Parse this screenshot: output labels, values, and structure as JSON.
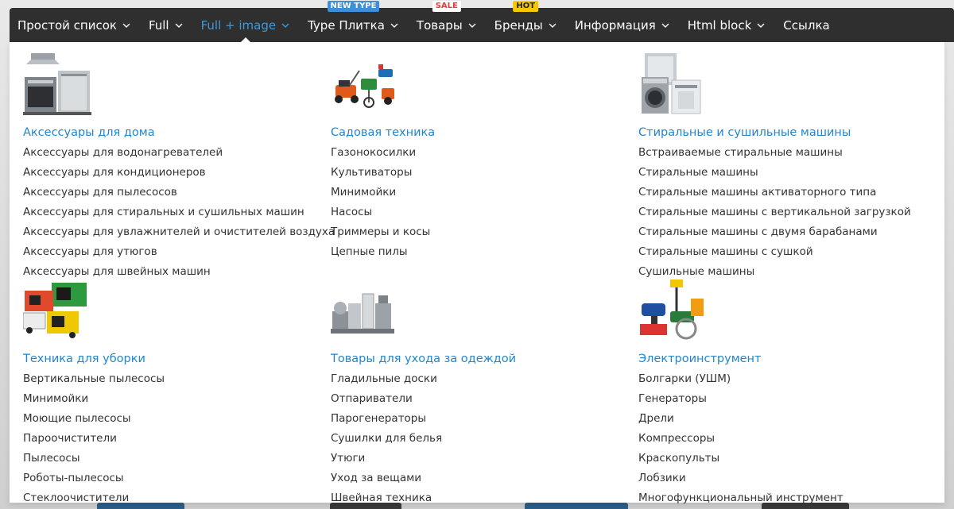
{
  "menu": {
    "items": [
      {
        "label": "Простой список",
        "has_dropdown": true,
        "active": false,
        "badge": null
      },
      {
        "label": "Full",
        "has_dropdown": true,
        "active": false,
        "badge": null
      },
      {
        "label": "Full + image",
        "has_dropdown": true,
        "active": true,
        "badge": null
      },
      {
        "label": "Type Плитка",
        "has_dropdown": true,
        "active": false,
        "badge": {
          "text": "NEW TYPE",
          "style": "new"
        }
      },
      {
        "label": "Товары",
        "has_dropdown": true,
        "active": false,
        "badge": {
          "text": "SALE",
          "style": "sale"
        }
      },
      {
        "label": "Бренды",
        "has_dropdown": true,
        "active": false,
        "badge": {
          "text": "HOT",
          "style": "hot"
        }
      },
      {
        "label": "Информация",
        "has_dropdown": true,
        "active": false,
        "badge": null
      },
      {
        "label": "Html block",
        "has_dropdown": true,
        "active": false,
        "badge": null
      },
      {
        "label": "Ссылка",
        "has_dropdown": false,
        "active": false,
        "badge": null
      }
    ],
    "colors": {
      "bar": "#2f2f2f",
      "active": "#3d9ade",
      "link": "#1f86cf"
    }
  },
  "dropdown": {
    "sections": [
      {
        "title": "Аксессуары для дома",
        "image": "kitchen-appliances-icon",
        "links": [
          "Аксессуары для водонагревателей",
          "Аксессуары для кондиционеров",
          "Аксессуары для пылесосов",
          "Аксессуары для стиральных и сушильных машин",
          "Аксессуары для увлажнителей и очистителей воздуха",
          "Аксессуары для утюгов",
          "Аксессуары для швейных машин"
        ]
      },
      {
        "title": "Садовая техника",
        "image": "garden-tools-icon",
        "links": [
          "Газонокосилки",
          "Культиваторы",
          "Минимойки",
          "Насосы",
          "Триммеры и косы",
          "Цепные пилы"
        ]
      },
      {
        "title": "Стиральные и сушильные машины",
        "image": "washing-machines-icon",
        "links": [
          "Встраиваемые стиральные машины",
          "Стиральные машины",
          "Стиральные машины активаторного типа",
          "Стиральные машины с вертикальной загрузкой",
          "Стиральные машины с двумя барабанами",
          "Стиральные машины с сушкой",
          "Сушильные машины"
        ]
      },
      {
        "title": "Техника для уборки",
        "image": "generators-icon",
        "links": [
          "Вертикальные пылесосы",
          "Минимойки",
          "Моющие пылесосы",
          "Пароочистители",
          "Пылесосы",
          "Роботы-пылесосы",
          "Стеклоочистители"
        ]
      },
      {
        "title": "Товары для ухода за одеждой",
        "image": "small-appliances-icon",
        "links": [
          "Гладильные доски",
          "Отпариватели",
          "Парогенераторы",
          "Сушилки для белья",
          "Утюги",
          "Уход за вещами",
          "Швейная техника"
        ]
      },
      {
        "title": "Электроинструмент",
        "image": "power-tools-icon",
        "links": [
          "Болгарки (УШМ)",
          "Генераторы",
          "Дрели",
          "Компрессоры",
          "Краскопульты",
          "Лобзики",
          "Многофункциональный инструмент"
        ]
      }
    ]
  }
}
